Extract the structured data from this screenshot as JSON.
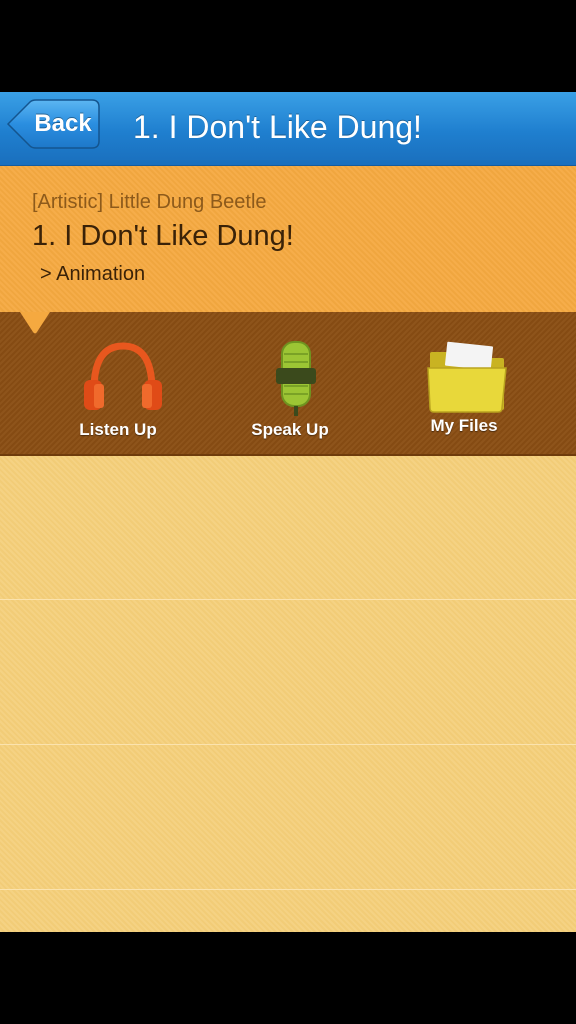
{
  "navbar": {
    "back_label": "Back",
    "title": "1. I Don't Like Dung!"
  },
  "info": {
    "series": "[Artistic] Little Dung Beetle",
    "title": "1. I Don't Like Dung!",
    "category": "> Animation"
  },
  "toolbar": {
    "items": [
      {
        "label": "Listen Up",
        "icon": "headphones-icon"
      },
      {
        "label": "Speak Up",
        "icon": "microphone-icon"
      },
      {
        "label": "My Files",
        "icon": "folder-icon"
      }
    ]
  },
  "colors": {
    "navbar": "#1f7fcf",
    "info_panel": "#f5a940",
    "toolbar": "#8a4e14",
    "content": "#f4cf7a"
  }
}
